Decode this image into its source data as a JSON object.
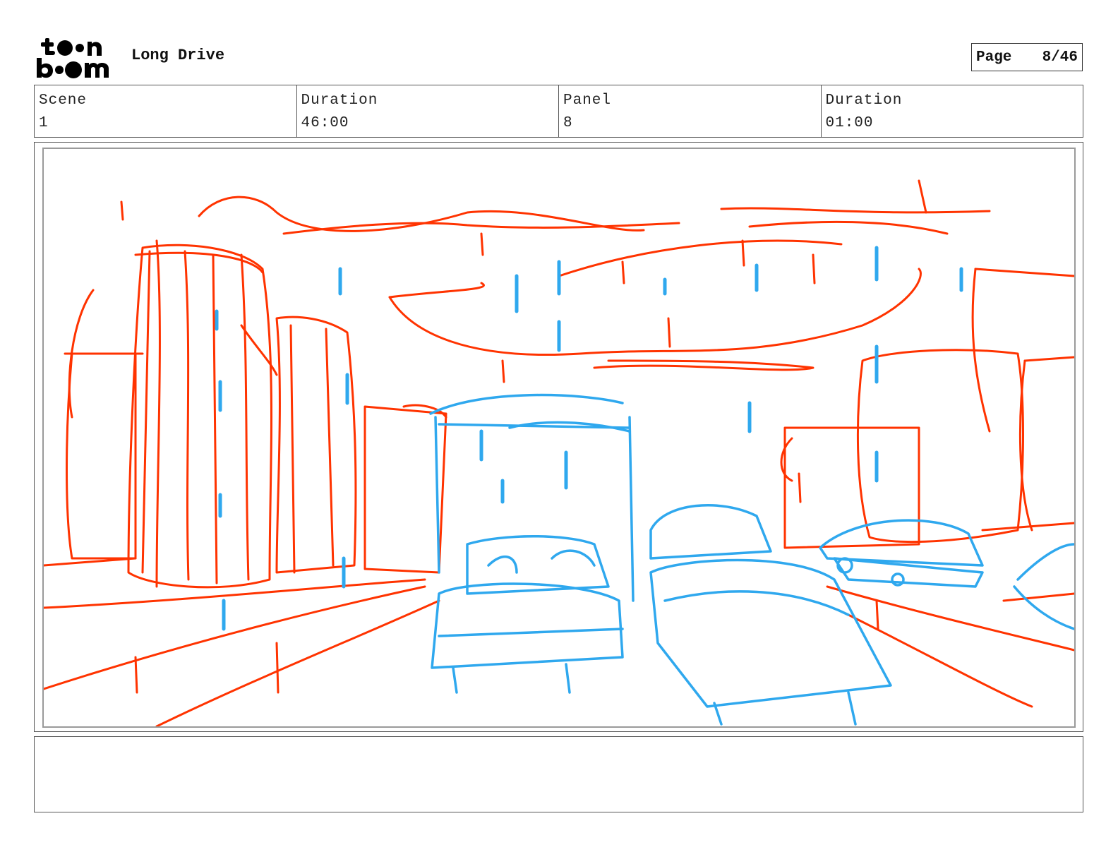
{
  "header": {
    "logo_text": "toon boom",
    "project_title": "Long Drive",
    "page_label": "Page",
    "page_number": "8/46"
  },
  "info": {
    "scene_label": "Scene",
    "scene_value": "1",
    "scene_duration_label": "Duration",
    "scene_duration_value": "46:00",
    "panel_label": "Panel",
    "panel_value": "8",
    "panel_duration_label": "Duration",
    "panel_duration_value": "01:00"
  },
  "panel": {
    "sketch_colors": {
      "background_lines": "#ff3300",
      "foreground_lines": "#2fa8ee"
    }
  },
  "notes": {
    "text": ""
  }
}
